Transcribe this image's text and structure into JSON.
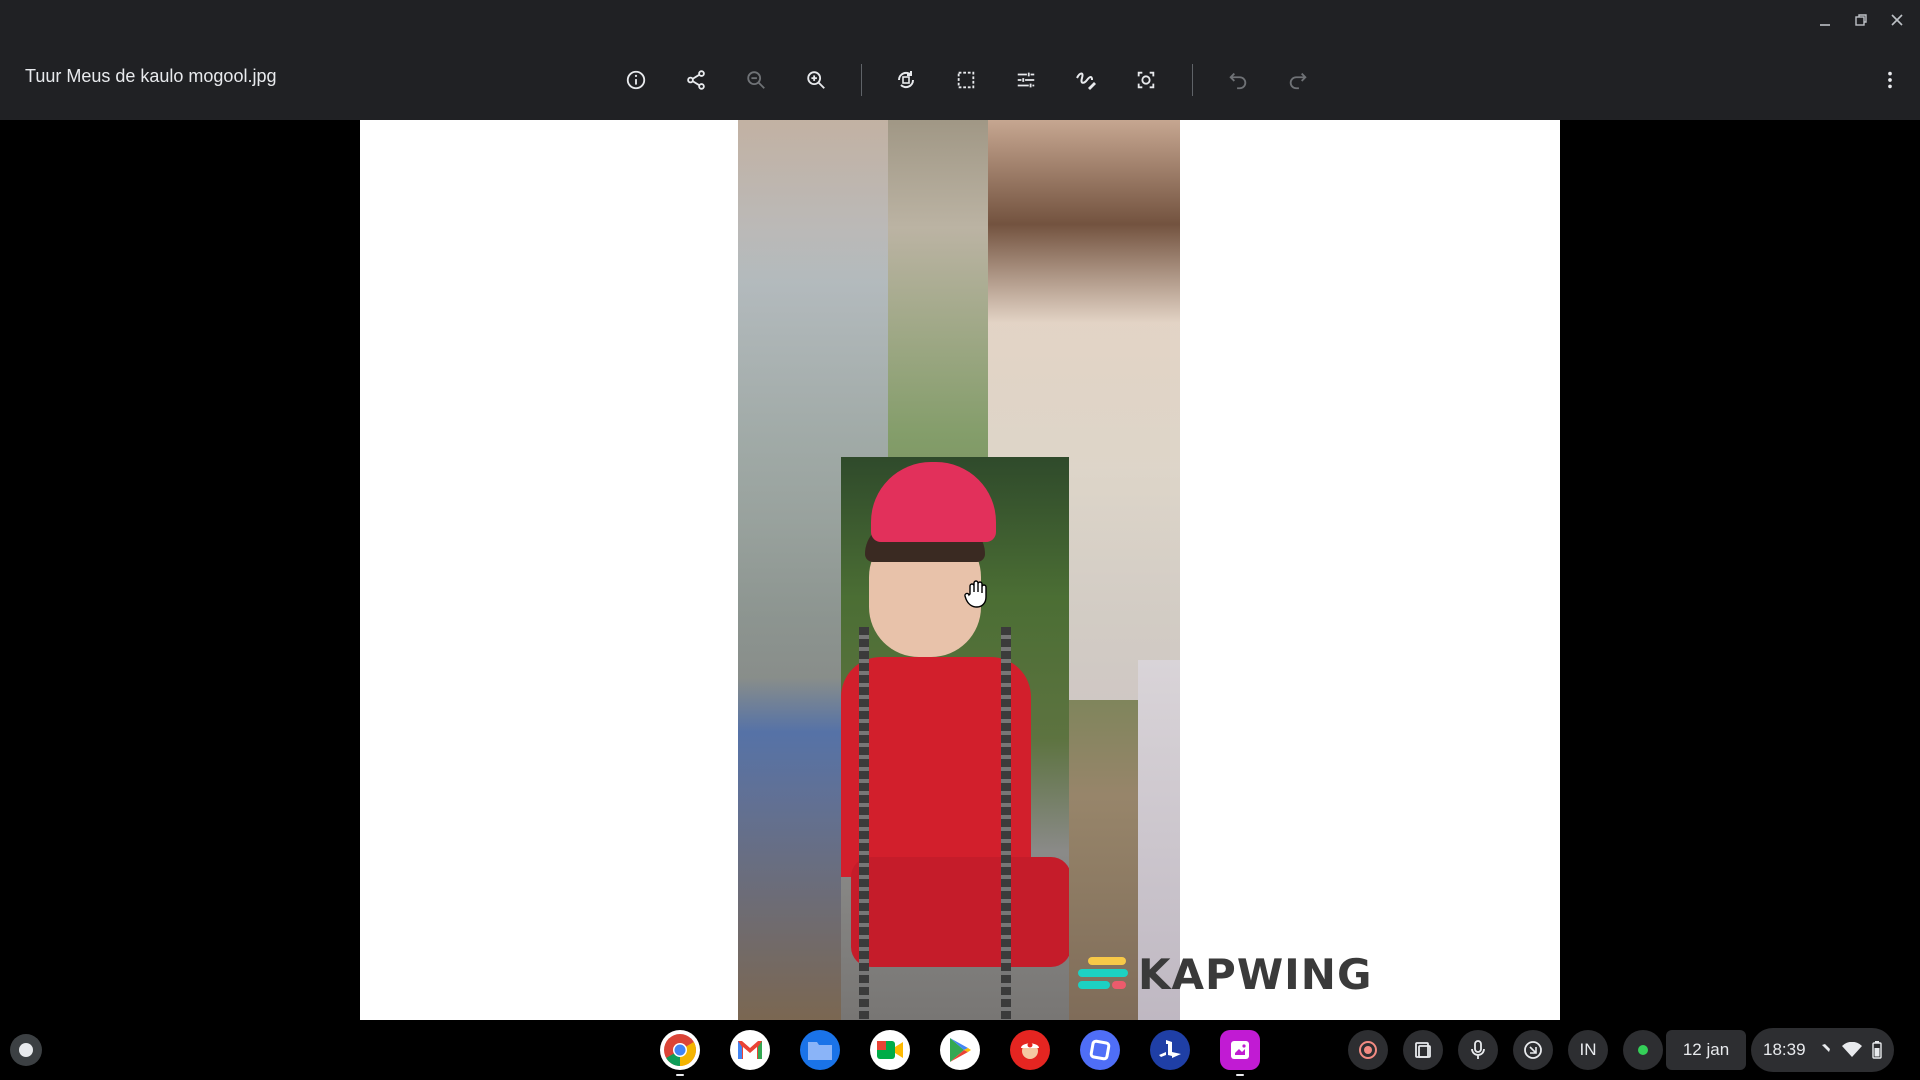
{
  "window": {
    "controls": [
      "minimize",
      "restore",
      "close"
    ]
  },
  "toolbar": {
    "filename": "Tuur Meus de kaulo mogool.jpg",
    "tools": [
      {
        "name": "info",
        "icon": "info-icon"
      },
      {
        "name": "share",
        "icon": "share-icon"
      },
      {
        "name": "zoom-out",
        "icon": "zoom-out-icon",
        "disabled": true
      },
      {
        "name": "zoom-in",
        "icon": "zoom-in-icon"
      },
      {
        "name": "rotate",
        "icon": "rotate-icon"
      },
      {
        "name": "crop",
        "icon": "crop-icon"
      },
      {
        "name": "adjust",
        "icon": "tune-icon"
      },
      {
        "name": "annotate",
        "icon": "draw-icon"
      },
      {
        "name": "rescale",
        "icon": "lens-icon"
      },
      {
        "name": "undo",
        "icon": "undo-icon",
        "disabled": true
      },
      {
        "name": "redo",
        "icon": "redo-icon",
        "disabled": true
      },
      {
        "name": "more",
        "icon": "more-vert-icon"
      }
    ]
  },
  "image": {
    "watermark_text": "KAPWING",
    "watermark_colors": [
      "#1dd1c2",
      "#f7c948",
      "#ec5b6c"
    ]
  },
  "shelf": {
    "apps": [
      {
        "name": "chrome",
        "icon": "chrome-icon",
        "color": "#4285f4",
        "running": true
      },
      {
        "name": "gmail",
        "icon": "gmail-icon",
        "color": "#ea4335"
      },
      {
        "name": "files",
        "icon": "files-icon",
        "color": "#1a73e8"
      },
      {
        "name": "meet",
        "icon": "meet-icon",
        "color": "#00ac47"
      },
      {
        "name": "play-store",
        "icon": "play-store-icon",
        "color": "#34a853"
      },
      {
        "name": "mario",
        "icon": "mario-icon",
        "color": "#e52521"
      },
      {
        "name": "app-blue",
        "icon": "square-app-icon",
        "color": "#4f6ef7"
      },
      {
        "name": "playstation",
        "icon": "playstation-icon",
        "color": "#1f3fa6"
      },
      {
        "name": "gallery",
        "icon": "gallery-icon",
        "color": "#c11bd3",
        "running": true
      }
    ],
    "tray": {
      "input_method": "IN",
      "date": "12 jan",
      "time": "18:39"
    }
  }
}
